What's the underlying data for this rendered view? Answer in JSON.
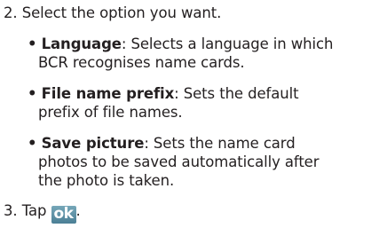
{
  "step2": {
    "number": "2.",
    "text": "Select the option you want."
  },
  "options": [
    {
      "bullet": "•",
      "name": "Language",
      "desc_line1": ": Selects a language in which",
      "desc_line2": "BCR recognises name cards."
    },
    {
      "bullet": "•",
      "name": "File name prefix",
      "desc_line1": ": Sets the default",
      "desc_line2": "prefix of file names."
    },
    {
      "bullet": "•",
      "name": "Save picture",
      "desc_line1": ": Sets the name card",
      "desc_line2": "photos to be saved automatically after",
      "desc_line3": "the photo is taken."
    }
  ],
  "step3": {
    "number": "3.",
    "text": "Tap",
    "button_label": "ok",
    "after": "."
  }
}
